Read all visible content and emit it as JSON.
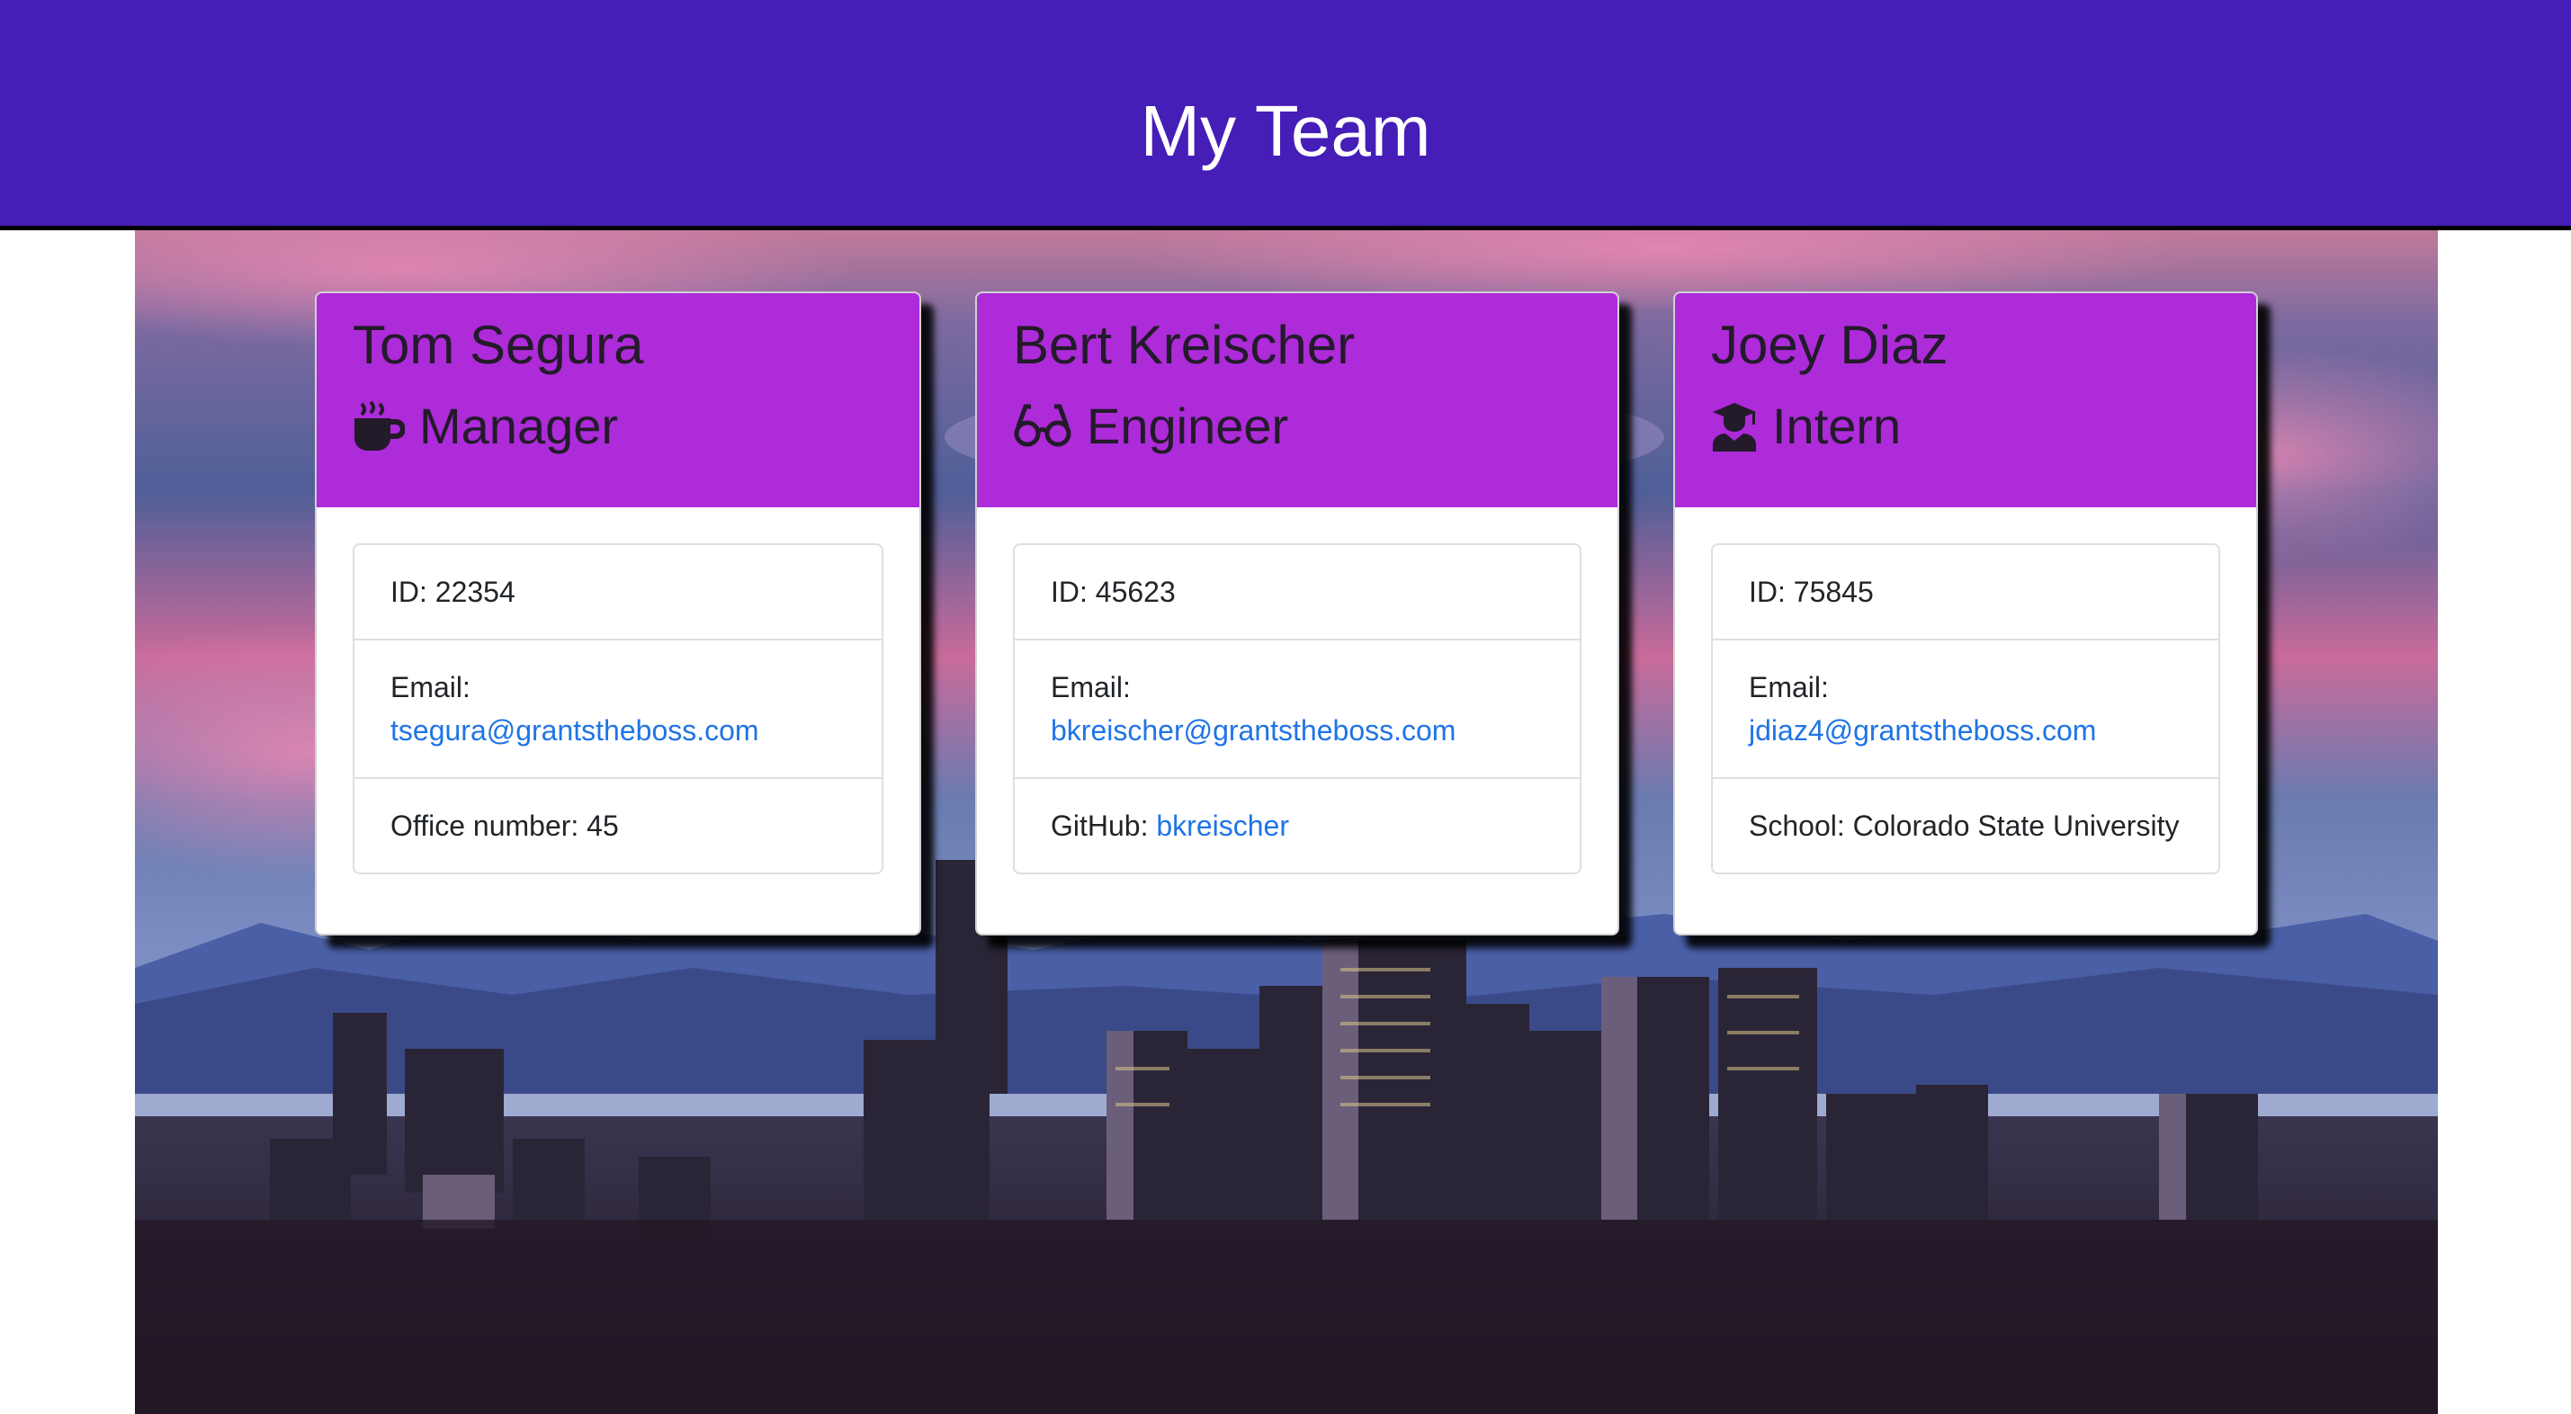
{
  "header": {
    "title": "My Team"
  },
  "cards": [
    {
      "name": "Tom Segura",
      "role": "Manager",
      "role_icon": "coffee-mug-icon",
      "id_text": "ID: 22354",
      "email_label": "Email:",
      "email": "tsegura@grantstheboss.com",
      "extra_text": "Office number: 45"
    },
    {
      "name": "Bert Kreischer",
      "role": "Engineer",
      "role_icon": "glasses-icon",
      "id_text": "ID: 45623",
      "email_label": "Email:",
      "email": "bkreischer@grantstheboss.com",
      "extra_label": "GitHub: ",
      "extra_link": "bkreischer"
    },
    {
      "name": "Joey Diaz",
      "role": "Intern",
      "role_icon": "graduate-icon",
      "id_text": "ID: 75845",
      "email_label": "Email:",
      "email": "jdiaz4@grantstheboss.com",
      "extra_text": "School: Colorado State University"
    }
  ],
  "colors": {
    "header_bg": "#451db7",
    "card_head_bg": "#ad2bd9",
    "link": "#1f74e6"
  }
}
